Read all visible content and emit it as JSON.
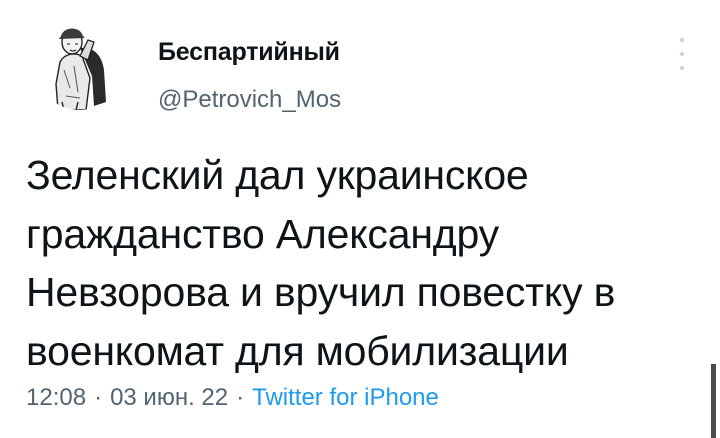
{
  "author": {
    "display_name": "Беспартийный",
    "handle": "@Petrovich_Mos",
    "avatar_icon": "caricature-avatar"
  },
  "menu": {
    "more_icon": "vertical-ellipsis-icon"
  },
  "tweet": {
    "lines": [
      "Зеленский дал украинское",
      "гражданство Александру",
      "Невзорова и вручил повестку в",
      "военкомат для мобилизации"
    ]
  },
  "meta": {
    "time": "12:08",
    "separator": "·",
    "date": "03 июн. 22",
    "source": "Twitter for iPhone"
  },
  "colors": {
    "text": "#0f1419",
    "secondary": "#536471",
    "link": "#1d9bf0",
    "background": "#ffffff"
  }
}
